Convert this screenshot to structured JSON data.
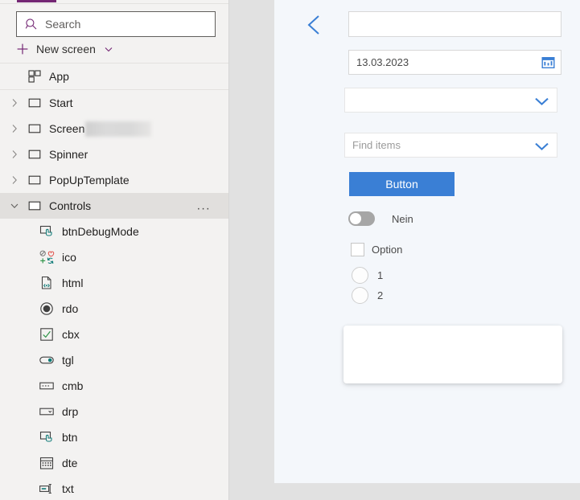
{
  "sidebar": {
    "search": {
      "placeholder": "Search",
      "icon": "search-icon"
    },
    "new_screen": {
      "label": "New screen",
      "icon": "plus-icon",
      "chevron": "chevron-down-icon"
    },
    "app_item": {
      "label": "App",
      "icon": "app-icon"
    },
    "tree": [
      {
        "label": "Start",
        "icon": "screen-icon",
        "twisty": "chevron-right-icon",
        "expanded": false,
        "selected": false,
        "redacted": false
      },
      {
        "label": "Screen",
        "icon": "screen-icon",
        "twisty": "chevron-right-icon",
        "expanded": false,
        "selected": false,
        "redacted": true
      },
      {
        "label": "Spinner",
        "icon": "screen-icon",
        "twisty": "chevron-right-icon",
        "expanded": false,
        "selected": false,
        "redacted": false
      },
      {
        "label": "PopUpTemplate",
        "icon": "screen-icon",
        "twisty": "chevron-right-icon",
        "expanded": false,
        "selected": false,
        "redacted": false
      },
      {
        "label": "Controls",
        "icon": "screen-icon",
        "twisty": "chevron-down-icon",
        "expanded": true,
        "selected": true,
        "redacted": false,
        "overflow": "..."
      }
    ],
    "controls": [
      {
        "label": "btnDebugMode",
        "icon": "button-icon"
      },
      {
        "label": "ico",
        "icon": "icon-set-icon"
      },
      {
        "label": "html",
        "icon": "html-text-icon"
      },
      {
        "label": "rdo",
        "icon": "radio-icon"
      },
      {
        "label": "cbx",
        "icon": "checkbox-icon"
      },
      {
        "label": "tgl",
        "icon": "toggle-icon"
      },
      {
        "label": "cmb",
        "icon": "combobox-icon"
      },
      {
        "label": "drp",
        "icon": "dropdown-icon"
      },
      {
        "label": "btn",
        "icon": "button-icon"
      },
      {
        "label": "dte",
        "icon": "calendar-icon"
      },
      {
        "label": "txt",
        "icon": "textinput-icon"
      }
    ],
    "accent_color": "#742774",
    "selected_row_color": "#e1dfdd"
  },
  "canvas": {
    "background_color": "#f4f7fb",
    "back_button": {
      "icon": "chevron-left-icon",
      "color": "#3a7fd5"
    },
    "text_input": {
      "value": "",
      "placeholder": ""
    },
    "date_input": {
      "value": "13.03.2023",
      "icon": "calendar-icon"
    },
    "dropdown": {
      "value": "",
      "icon": "chevron-down-icon"
    },
    "combobox": {
      "placeholder": "Find items",
      "icon": "chevron-down-icon"
    },
    "button": {
      "label": "Button",
      "color": "#3a7fd5"
    },
    "toggle": {
      "label": "Nein",
      "state": "off"
    },
    "checkbox": {
      "label": "Option",
      "checked": false
    },
    "radios": [
      {
        "label": "1",
        "selected": false
      },
      {
        "label": "2",
        "selected": false
      }
    ],
    "card": {
      "content": ""
    }
  }
}
